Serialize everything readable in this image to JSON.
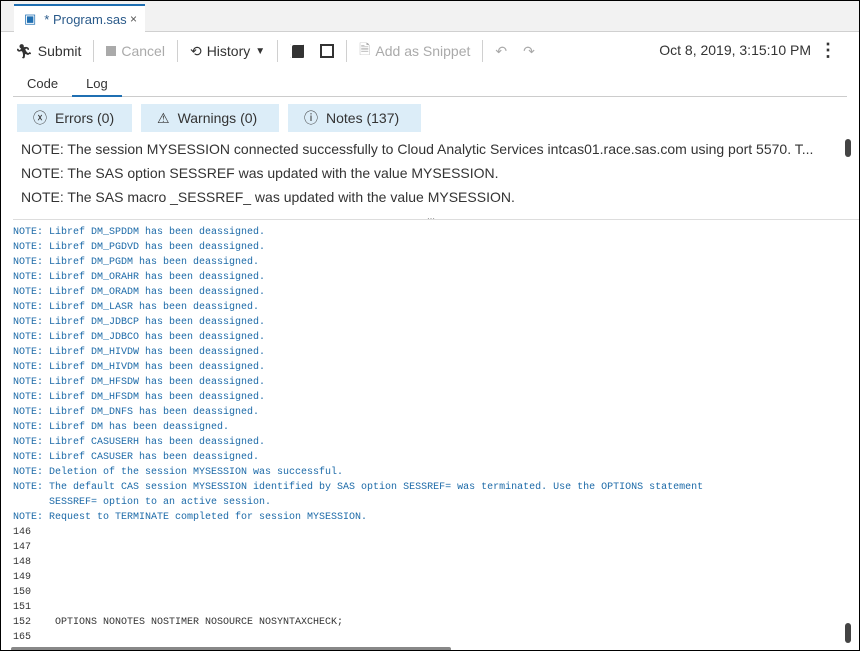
{
  "tab": {
    "title": "* Program.sas",
    "close": "×"
  },
  "toolbar": {
    "submit": "Submit",
    "cancel": "Cancel",
    "history": "History",
    "add_snippet": "Add as Snippet",
    "timestamp": "Oct 8, 2019, 3:15:10 PM"
  },
  "subtabs": [
    "Code",
    "Log"
  ],
  "filters": {
    "errors": "Errors (0)",
    "warnings": "Warnings (0)",
    "notes": "Notes (137)"
  },
  "summary": [
    "NOTE: The session MYSESSION connected successfully to Cloud Analytic Services intcas01.race.sas.com using port 5570. T...",
    "NOTE: The SAS option SESSREF was updated with the value MYSESSION.",
    "NOTE: The SAS macro _SESSREF_ was updated with the value MYSESSION."
  ],
  "log": [
    {
      "t": "NOTE: Libref DM_SPDDM has been deassigned.",
      "k": "note"
    },
    {
      "t": "NOTE: Libref DM_PGDVD has been deassigned.",
      "k": "note"
    },
    {
      "t": "NOTE: Libref DM_PGDM has been deassigned.",
      "k": "note"
    },
    {
      "t": "NOTE: Libref DM_ORAHR has been deassigned.",
      "k": "note"
    },
    {
      "t": "NOTE: Libref DM_ORADM has been deassigned.",
      "k": "note"
    },
    {
      "t": "NOTE: Libref DM_LASR has been deassigned.",
      "k": "note"
    },
    {
      "t": "NOTE: Libref DM_JDBCP has been deassigned.",
      "k": "note"
    },
    {
      "t": "NOTE: Libref DM_JDBCO has been deassigned.",
      "k": "note"
    },
    {
      "t": "NOTE: Libref DM_HIVDW has been deassigned.",
      "k": "note"
    },
    {
      "t": "NOTE: Libref DM_HIVDM has been deassigned.",
      "k": "note"
    },
    {
      "t": "NOTE: Libref DM_HFSDW has been deassigned.",
      "k": "note"
    },
    {
      "t": "NOTE: Libref DM_HFSDM has been deassigned.",
      "k": "note"
    },
    {
      "t": "NOTE: Libref DM_DNFS has been deassigned.",
      "k": "note"
    },
    {
      "t": "NOTE: Libref DM has been deassigned.",
      "k": "note"
    },
    {
      "t": "NOTE: Libref CASUSERH has been deassigned.",
      "k": "note"
    },
    {
      "t": "NOTE: Libref CASUSER has been deassigned.",
      "k": "note"
    },
    {
      "t": "NOTE: Deletion of the session MYSESSION was successful.",
      "k": "note"
    },
    {
      "t": "NOTE: The default CAS session MYSESSION identified by SAS option SESSREF= was terminated. Use the OPTIONS statement",
      "k": "note"
    },
    {
      "t": "      SESSREF= option to an active session.",
      "k": "note"
    },
    {
      "t": "NOTE: Request to TERMINATE completed for session MYSESSION.",
      "k": "note"
    },
    {
      "t": "146",
      "k": "num"
    },
    {
      "t": "147",
      "k": "num"
    },
    {
      "t": "148",
      "k": "num"
    },
    {
      "t": "149",
      "k": "num"
    },
    {
      "t": "150",
      "k": "num"
    },
    {
      "t": "151",
      "k": "num"
    },
    {
      "t": "152    OPTIONS NONOTES NOSTIMER NOSOURCE NOSYNTAXCHECK;",
      "k": "num"
    },
    {
      "t": "165",
      "k": "num"
    }
  ]
}
